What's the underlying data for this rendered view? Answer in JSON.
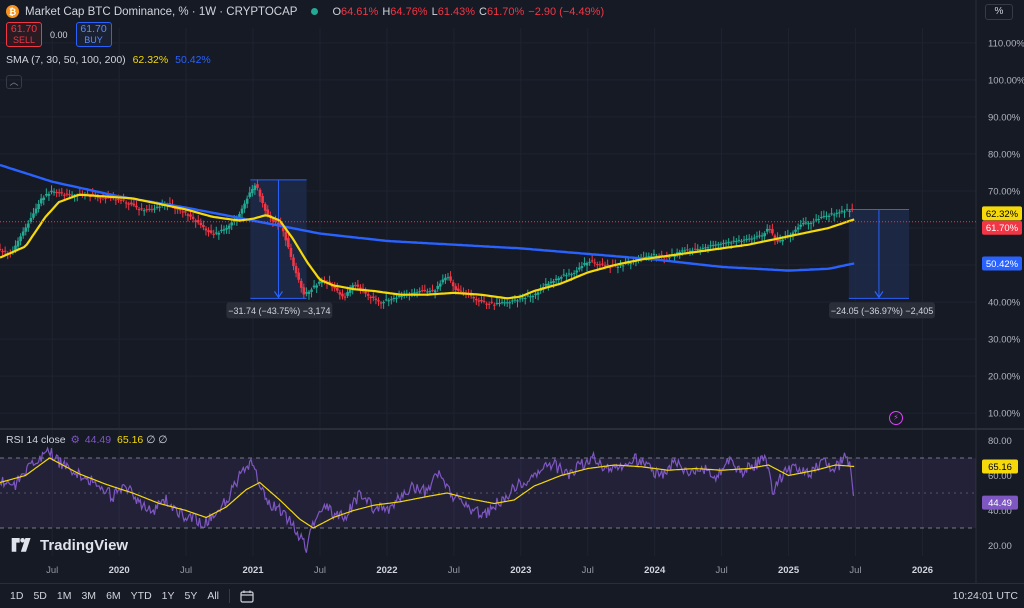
{
  "header": {
    "logo_letter": "₿",
    "title": "Market Cap BTC Dominance, % · 1W · CRYPTOCAP",
    "ohlc": [
      {
        "k": "O",
        "v": "64.61%"
      },
      {
        "k": "H",
        "v": "64.76%"
      },
      {
        "k": "L",
        "v": "61.43%"
      },
      {
        "k": "C",
        "v": "61.70%"
      },
      {
        "k": "",
        "v": "−2.90 (−4.49%)"
      }
    ],
    "scale_mode": "%"
  },
  "trade": {
    "sell_price": "61.70",
    "sell_label": "SELL",
    "spread": "0.00",
    "buy_price": "61.70",
    "buy_label": "BUY"
  },
  "indicators": {
    "sma_label": "SMA (7, 30, 50, 100, 200)",
    "sma_val_1": "62.32%",
    "sma_val_2": "50.42%",
    "collapse_icon": "chevron-up-icon",
    "rsi_label": "RSI 14 close",
    "rsi_val": "44.49",
    "rsi_ma_val": "65.16",
    "rsi_extra": "∅ ∅"
  },
  "colors": {
    "bg": "#161a25",
    "up": "#22ab94",
    "down": "#f23645",
    "sma_short": "#f5d90a",
    "sma_long": "#2962ff",
    "rsi": "#7e57c2",
    "measure_fill": "#1e2c4e",
    "measure_line": "#2962ff"
  },
  "brand": "TradingView",
  "chart_data": {
    "type": "candlestick",
    "y_axis_labels": [
      "110.00%",
      "100.00%",
      "90.00%",
      "80.00%",
      "70.00%",
      "60.00%",
      "50.00%",
      "40.00%",
      "30.00%",
      "20.00%",
      "10.00%"
    ],
    "y_ticks": [
      110,
      100,
      90,
      80,
      70,
      60,
      50,
      40,
      30,
      20,
      10
    ],
    "ylim": [
      6,
      114
    ],
    "x_axis_labels": [
      "Jul",
      "2020",
      "Jul",
      "2021",
      "Jul",
      "2022",
      "Jul",
      "2023",
      "Jul",
      "2024",
      "Jul",
      "2025",
      "Jul",
      "2026"
    ],
    "x_ticks": [
      2019.5,
      2020.0,
      2020.5,
      2021.0,
      2021.5,
      2022.0,
      2022.5,
      2023.0,
      2023.5,
      2024.0,
      2024.5,
      2025.0,
      2025.5,
      2026.0
    ],
    "xlim": [
      2019.11,
      2026.4
    ],
    "price_anchors": [
      [
        2019.11,
        54
      ],
      [
        2019.2,
        53
      ],
      [
        2019.25,
        57
      ],
      [
        2019.35,
        63
      ],
      [
        2019.42,
        68
      ],
      [
        2019.5,
        70
      ],
      [
        2019.6,
        69
      ],
      [
        2019.75,
        69
      ],
      [
        2019.85,
        68.5
      ],
      [
        2019.95,
        68
      ],
      [
        2020.05,
        67
      ],
      [
        2020.15,
        65
      ],
      [
        2020.25,
        65
      ],
      [
        2020.35,
        66.5
      ],
      [
        2020.5,
        64
      ],
      [
        2020.6,
        61
      ],
      [
        2020.7,
        58
      ],
      [
        2020.8,
        60
      ],
      [
        2020.9,
        64
      ],
      [
        2020.97,
        69
      ],
      [
        2021.02,
        72
      ],
      [
        2021.1,
        64
      ],
      [
        2021.15,
        62
      ],
      [
        2021.22,
        60
      ],
      [
        2021.3,
        50
      ],
      [
        2021.38,
        42
      ],
      [
        2021.45,
        44
      ],
      [
        2021.52,
        46
      ],
      [
        2021.6,
        44
      ],
      [
        2021.68,
        41
      ],
      [
        2021.75,
        45
      ],
      [
        2021.85,
        42
      ],
      [
        2021.95,
        40
      ],
      [
        2022.05,
        41
      ],
      [
        2022.15,
        42
      ],
      [
        2022.25,
        43
      ],
      [
        2022.35,
        43
      ],
      [
        2022.42,
        46
      ],
      [
        2022.45,
        47
      ],
      [
        2022.52,
        43
      ],
      [
        2022.6,
        42
      ],
      [
        2022.7,
        40
      ],
      [
        2022.8,
        39.5
      ],
      [
        2022.9,
        40
      ],
      [
        2023.0,
        41
      ],
      [
        2023.1,
        42
      ],
      [
        2023.2,
        45
      ],
      [
        2023.3,
        47
      ],
      [
        2023.4,
        48
      ],
      [
        2023.5,
        51
      ],
      [
        2023.6,
        50
      ],
      [
        2023.7,
        49.5
      ],
      [
        2023.85,
        51
      ],
      [
        2024.0,
        53
      ],
      [
        2024.1,
        52
      ],
      [
        2024.2,
        54
      ],
      [
        2024.3,
        54
      ],
      [
        2024.4,
        55
      ],
      [
        2024.5,
        56
      ],
      [
        2024.6,
        56.5
      ],
      [
        2024.7,
        57
      ],
      [
        2024.8,
        58
      ],
      [
        2024.85,
        60
      ],
      [
        2024.92,
        56
      ],
      [
        2025.0,
        58
      ],
      [
        2025.1,
        61
      ],
      [
        2025.2,
        62
      ],
      [
        2025.3,
        63.5
      ],
      [
        2025.4,
        64.5
      ],
      [
        2025.45,
        65
      ],
      [
        2025.48,
        64.6
      ],
      [
        2025.49,
        61.7
      ]
    ],
    "sma_short_anchors": [
      [
        2019.11,
        52
      ],
      [
        2019.3,
        55
      ],
      [
        2019.45,
        63
      ],
      [
        2019.55,
        67
      ],
      [
        2019.7,
        69
      ],
      [
        2019.9,
        68.5
      ],
      [
        2020.1,
        68
      ],
      [
        2020.3,
        66.5
      ],
      [
        2020.5,
        65
      ],
      [
        2020.7,
        63
      ],
      [
        2020.9,
        62
      ],
      [
        2021.0,
        62.5
      ],
      [
        2021.1,
        63.5
      ],
      [
        2021.2,
        62
      ],
      [
        2021.3,
        57
      ],
      [
        2021.4,
        51
      ],
      [
        2021.5,
        46
      ],
      [
        2021.6,
        44.5
      ],
      [
        2021.75,
        43.5
      ],
      [
        2021.9,
        43
      ],
      [
        2022.1,
        42
      ],
      [
        2022.3,
        42
      ],
      [
        2022.5,
        42.5
      ],
      [
        2022.7,
        42
      ],
      [
        2022.9,
        41
      ],
      [
        2023.0,
        41.5
      ],
      [
        2023.1,
        43
      ],
      [
        2023.3,
        45
      ],
      [
        2023.5,
        48
      ],
      [
        2023.7,
        50
      ],
      [
        2023.9,
        51.5
      ],
      [
        2024.1,
        52.5
      ],
      [
        2024.3,
        53.5
      ],
      [
        2024.5,
        54.5
      ],
      [
        2024.7,
        55.5
      ],
      [
        2024.9,
        57
      ],
      [
        2025.1,
        58.5
      ],
      [
        2025.3,
        60
      ],
      [
        2025.49,
        62.32
      ]
    ],
    "sma_long_anchors": [
      [
        2019.11,
        77
      ],
      [
        2019.5,
        72.5
      ],
      [
        2020.0,
        68.5
      ],
      [
        2020.5,
        65.5
      ],
      [
        2021.0,
        62
      ],
      [
        2021.5,
        58.5
      ],
      [
        2022.0,
        56.5
      ],
      [
        2022.5,
        55.5
      ],
      [
        2023.0,
        54.5
      ],
      [
        2023.5,
        53
      ],
      [
        2024.0,
        51.5
      ],
      [
        2024.5,
        49.5
      ],
      [
        2025.0,
        48.5
      ],
      [
        2025.3,
        49
      ],
      [
        2025.49,
        50.42
      ]
    ],
    "measure_1": {
      "x_start": 2020.98,
      "x_end": 2021.4,
      "y_start": 73,
      "y_end": 41,
      "label": "−31.74 (−43.75%) −3,174"
    },
    "measure_2": {
      "x_start": 2025.45,
      "x_end": 2025.9,
      "y_start": 65,
      "y_end": 41,
      "label": "−24.05 (−36.97%) −2,405"
    },
    "current_price": 61.7,
    "axis_tags": [
      {
        "value": 62.32,
        "label": "62.32%",
        "bg": "#f5d90a",
        "fg": "#000000"
      },
      {
        "value": 61.7,
        "label": "61.70%",
        "bg": "#f23645",
        "fg": "#ffffff"
      },
      {
        "value": 50.42,
        "label": "50.42%",
        "bg": "#2962ff",
        "fg": "#ffffff"
      }
    ],
    "rsi": {
      "y_axis_labels": [
        "80.00",
        "60.00",
        "40.00",
        "20.00"
      ],
      "y_ticks": [
        80,
        60,
        40,
        20
      ],
      "ylim": [
        14,
        86
      ],
      "upper_band": 70,
      "lower_band": 30,
      "rsi_anchors": [
        [
          2019.11,
          58
        ],
        [
          2019.2,
          52
        ],
        [
          2019.3,
          63
        ],
        [
          2019.4,
          70
        ],
        [
          2019.48,
          74
        ],
        [
          2019.55,
          68
        ],
        [
          2019.65,
          62
        ],
        [
          2019.75,
          58
        ],
        [
          2019.85,
          55
        ],
        [
          2019.95,
          48
        ],
        [
          2020.05,
          54
        ],
        [
          2020.15,
          44
        ],
        [
          2020.25,
          40
        ],
        [
          2020.35,
          46
        ],
        [
          2020.45,
          38
        ],
        [
          2020.55,
          36
        ],
        [
          2020.62,
          33
        ],
        [
          2020.7,
          36
        ],
        [
          2020.8,
          45
        ],
        [
          2020.9,
          60
        ],
        [
          2021.0,
          68
        ],
        [
          2021.05,
          56
        ],
        [
          2021.1,
          44
        ],
        [
          2021.2,
          40
        ],
        [
          2021.3,
          32
        ],
        [
          2021.36,
          24
        ],
        [
          2021.4,
          18
        ],
        [
          2021.45,
          33
        ],
        [
          2021.55,
          44
        ],
        [
          2021.62,
          36
        ],
        [
          2021.7,
          38
        ],
        [
          2021.8,
          50
        ],
        [
          2021.9,
          42
        ],
        [
          2022.0,
          40
        ],
        [
          2022.1,
          47
        ],
        [
          2022.2,
          54
        ],
        [
          2022.3,
          50
        ],
        [
          2022.38,
          62
        ],
        [
          2022.45,
          52
        ],
        [
          2022.55,
          44
        ],
        [
          2022.65,
          40
        ],
        [
          2022.75,
          38
        ],
        [
          2022.85,
          46
        ],
        [
          2022.95,
          53
        ],
        [
          2023.05,
          58
        ],
        [
          2023.15,
          63
        ],
        [
          2023.25,
          66
        ],
        [
          2023.35,
          60
        ],
        [
          2023.45,
          66
        ],
        [
          2023.55,
          71
        ],
        [
          2023.65,
          63
        ],
        [
          2023.75,
          65
        ],
        [
          2023.85,
          70
        ],
        [
          2023.95,
          64
        ],
        [
          2024.05,
          60
        ],
        [
          2024.15,
          68
        ],
        [
          2024.25,
          62
        ],
        [
          2024.35,
          65
        ],
        [
          2024.45,
          60
        ],
        [
          2024.55,
          68
        ],
        [
          2024.65,
          62
        ],
        [
          2024.75,
          66
        ],
        [
          2024.82,
          71
        ],
        [
          2024.88,
          51
        ],
        [
          2024.95,
          60
        ],
        [
          2025.05,
          66
        ],
        [
          2025.15,
          61
        ],
        [
          2025.25,
          68
        ],
        [
          2025.35,
          64
        ],
        [
          2025.42,
          70
        ],
        [
          2025.46,
          67
        ],
        [
          2025.49,
          44.49
        ]
      ],
      "rsi_ma_anchors": [
        [
          2019.11,
          56
        ],
        [
          2019.3,
          60
        ],
        [
          2019.48,
          70
        ],
        [
          2019.7,
          61
        ],
        [
          2019.9,
          55
        ],
        [
          2020.1,
          50
        ],
        [
          2020.3,
          44
        ],
        [
          2020.5,
          40
        ],
        [
          2020.65,
          36
        ],
        [
          2020.8,
          42
        ],
        [
          2020.95,
          52
        ],
        [
          2021.05,
          56
        ],
        [
          2021.2,
          46
        ],
        [
          2021.35,
          35
        ],
        [
          2021.45,
          30
        ],
        [
          2021.6,
          36
        ],
        [
          2021.75,
          40
        ],
        [
          2021.9,
          43
        ],
        [
          2022.1,
          45
        ],
        [
          2022.3,
          48
        ],
        [
          2022.45,
          50
        ],
        [
          2022.6,
          47
        ],
        [
          2022.8,
          44
        ],
        [
          2022.95,
          46
        ],
        [
          2023.1,
          54
        ],
        [
          2023.3,
          60
        ],
        [
          2023.5,
          64
        ],
        [
          2023.7,
          66
        ],
        [
          2023.9,
          65
        ],
        [
          2024.1,
          63
        ],
        [
          2024.3,
          64
        ],
        [
          2024.5,
          63
        ],
        [
          2024.7,
          64
        ],
        [
          2024.85,
          66
        ],
        [
          2025.0,
          60
        ],
        [
          2025.2,
          63
        ],
        [
          2025.35,
          66
        ],
        [
          2025.49,
          65.16
        ]
      ],
      "axis_tags": [
        {
          "value": 65.16,
          "label": "65.16",
          "bg": "#f5d90a",
          "fg": "#000000"
        },
        {
          "value": 44.49,
          "label": "44.49",
          "bg": "#7e57c2",
          "fg": "#ffffff"
        }
      ]
    }
  },
  "bottom_bar": {
    "ranges": [
      "1D",
      "5D",
      "1M",
      "3M",
      "6M",
      "YTD",
      "1Y",
      "5Y",
      "All"
    ],
    "time": "10:24:01 UTC"
  }
}
